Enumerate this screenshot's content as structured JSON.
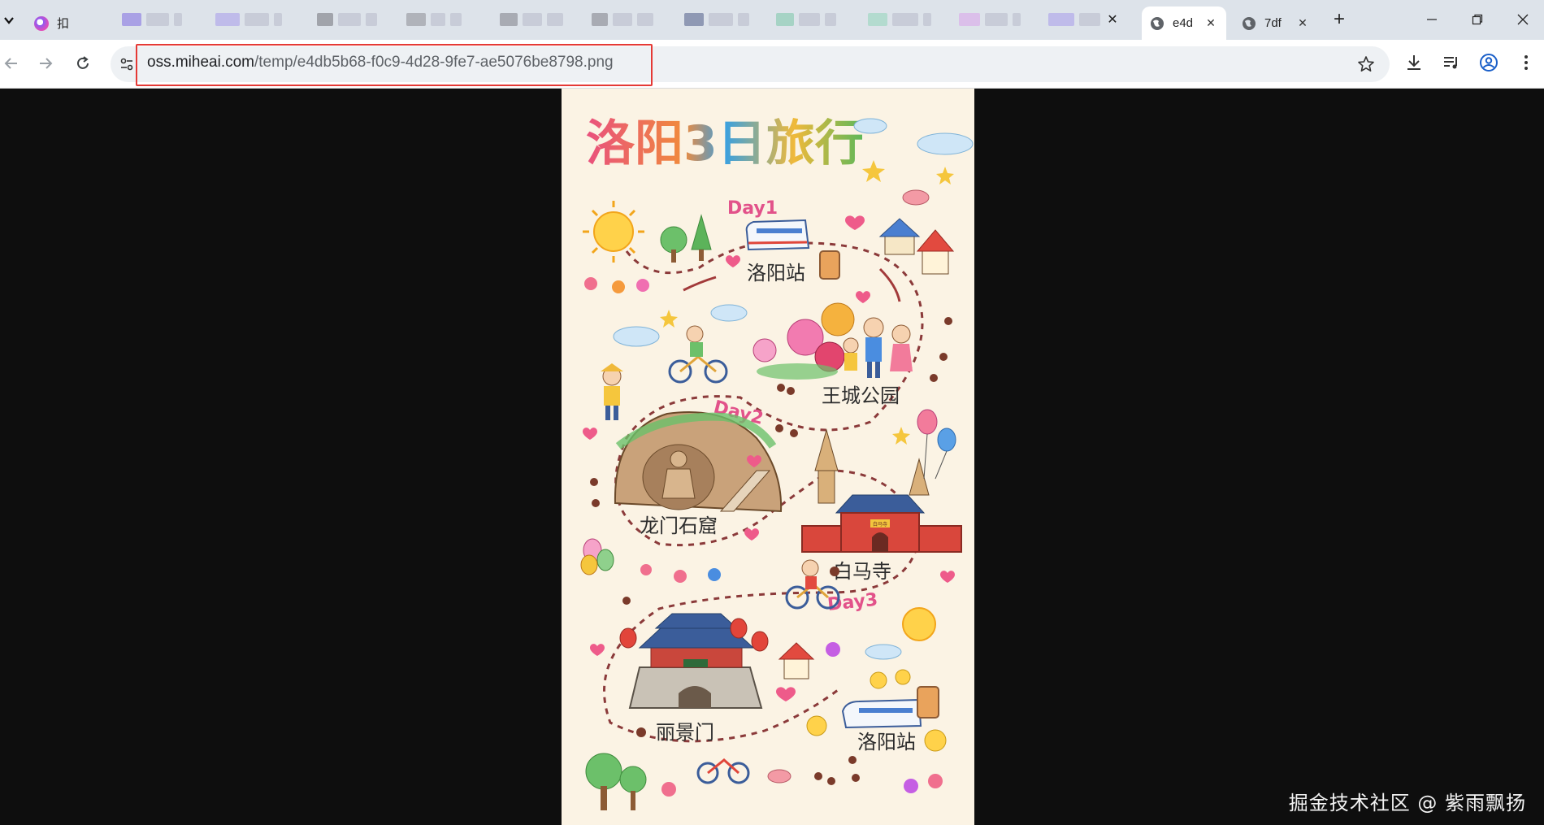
{
  "tabs": {
    "first_title": "扣",
    "active_title": "e4d",
    "other_title": "7df",
    "close_glyph": "✕",
    "new_tab_glyph": "+"
  },
  "address_bar": {
    "url_host": "oss.miheai.com",
    "url_path": "/temp/e4db5b68-f0c9-4d28-9fe7-ae5076be8798.png"
  },
  "poster": {
    "title": "洛阳3日旅行",
    "day1": "Day1",
    "day2": "Day2",
    "day3": "Day3",
    "stop_luoyang_station_1": "洛阳站",
    "stop_wangcheng_park": "王城公园",
    "stop_longmen": "龙门石窟",
    "stop_baima": "白马寺",
    "stop_lijing_gate": "丽景门",
    "stop_luoyang_station_2": "洛阳站",
    "gate_plaque": "白马寺"
  },
  "watermark": "掘金技术社区 @ 紫雨飘扬",
  "colors": {
    "tabstrip_bg": "#dde3ea",
    "viewer_bg": "#0e0e0e",
    "poster_bg": "#fbf3e4",
    "highlight_red": "#e53935",
    "path_brown": "#8b3a3a",
    "day_pink": "#e2528a"
  }
}
